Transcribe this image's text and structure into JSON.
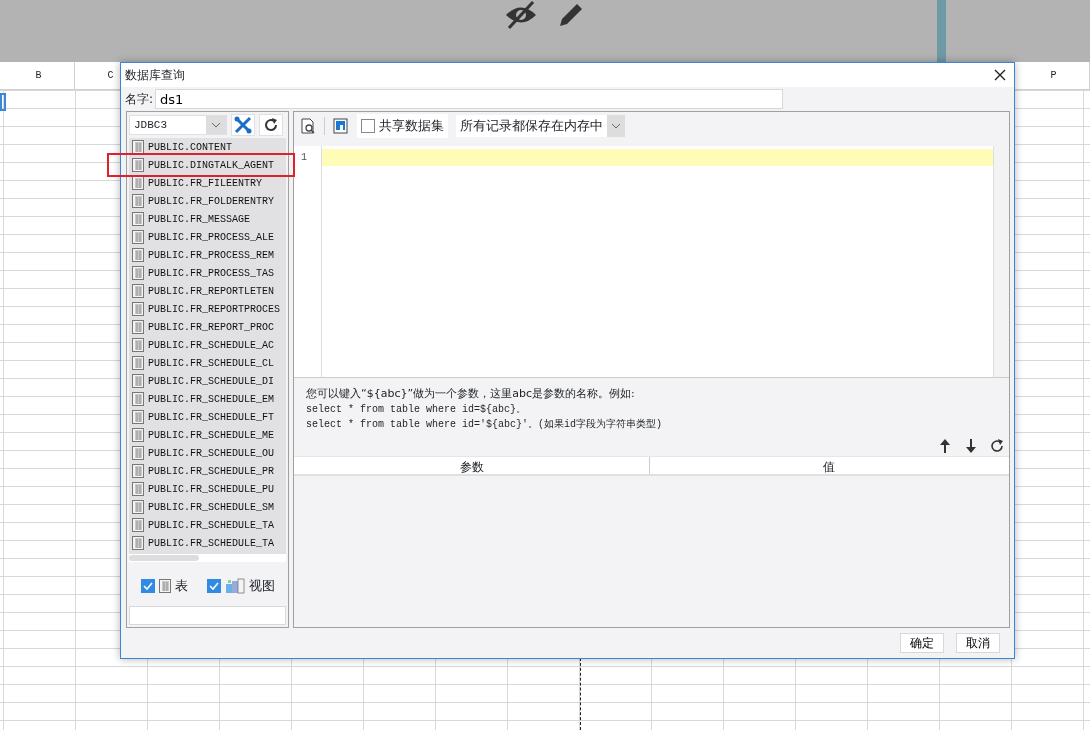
{
  "sheet": {
    "column_headers": [
      "B",
      "C",
      "P"
    ]
  },
  "dialog": {
    "title": "数据库查询",
    "name_label": "名字:",
    "name_value": "ds1",
    "connection": "JDBC3",
    "tables": [
      {
        "name": "PUBLIC.CONTENT",
        "highlighted": false
      },
      {
        "name": "PUBLIC.DINGTALK_AGENT",
        "highlighted": true
      },
      {
        "name": "PUBLIC.FR_FILEENTRY",
        "highlighted": false
      },
      {
        "name": "PUBLIC.FR_FOLDERENTRY",
        "highlighted": false
      },
      {
        "name": "PUBLIC.FR_MESSAGE",
        "highlighted": false
      },
      {
        "name": "PUBLIC.FR_PROCESS_ALE",
        "highlighted": false
      },
      {
        "name": "PUBLIC.FR_PROCESS_REM",
        "highlighted": false
      },
      {
        "name": "PUBLIC.FR_PROCESS_TAS",
        "highlighted": false
      },
      {
        "name": "PUBLIC.FR_REPORTLETEN",
        "highlighted": false
      },
      {
        "name": "PUBLIC.FR_REPORTPROCES",
        "highlighted": false
      },
      {
        "name": "PUBLIC.FR_REPORT_PROC",
        "highlighted": false
      },
      {
        "name": "PUBLIC.FR_SCHEDULE_AC",
        "highlighted": false
      },
      {
        "name": "PUBLIC.FR_SCHEDULE_CL",
        "highlighted": false
      },
      {
        "name": "PUBLIC.FR_SCHEDULE_DI",
        "highlighted": false
      },
      {
        "name": "PUBLIC.FR_SCHEDULE_EM",
        "highlighted": false
      },
      {
        "name": "PUBLIC.FR_SCHEDULE_FT",
        "highlighted": false
      },
      {
        "name": "PUBLIC.FR_SCHEDULE_ME",
        "highlighted": false
      },
      {
        "name": "PUBLIC.FR_SCHEDULE_OU",
        "highlighted": false
      },
      {
        "name": "PUBLIC.FR_SCHEDULE_PR",
        "highlighted": false
      },
      {
        "name": "PUBLIC.FR_SCHEDULE_PU",
        "highlighted": false
      },
      {
        "name": "PUBLIC.FR_SCHEDULE_SM",
        "highlighted": false
      },
      {
        "name": "PUBLIC.FR_SCHEDULE_TA",
        "highlighted": false
      },
      {
        "name": "PUBLIC.FR_SCHEDULE_TA",
        "highlighted": false
      }
    ],
    "filters": [
      {
        "label": "表",
        "checked": true,
        "kind": "table"
      },
      {
        "label": "视图",
        "checked": true,
        "kind": "view"
      }
    ],
    "share_dataset": {
      "label": "共享数据集",
      "checked": false
    },
    "storage_mode": "所有记录都保存在内存中",
    "editor": {
      "line_numbers": [
        "1"
      ]
    },
    "hint_lines": [
      "您可以键入“${abc}”做为一个参数，这里abc是参数的名称。例如:",
      "select * from table where id=${abc}。",
      "select * from table where id='${abc}'。(如果id字段为字符串类型)"
    ],
    "param_columns": [
      "参数",
      "值"
    ],
    "buttons": [
      "确定",
      "取消"
    ]
  }
}
